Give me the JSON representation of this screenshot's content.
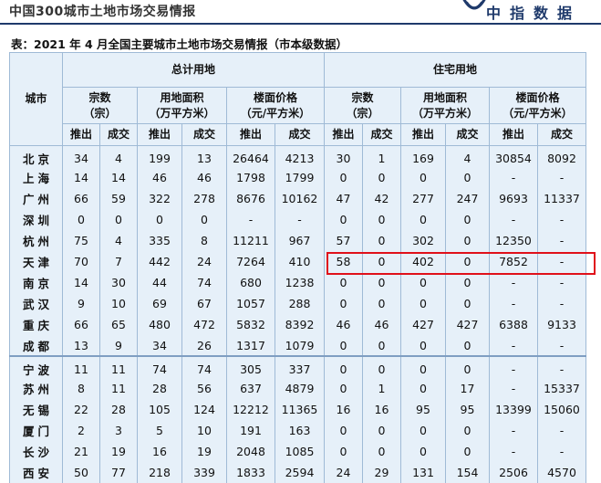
{
  "header": {
    "left_title": "中国300城市土地市场交易情报",
    "brand": "中指数据",
    "logo_icon": "zhongzhi-logo-icon"
  },
  "caption": "表：2021 年 4 月全国主要城市土地市场交易情报（市本级数据）",
  "table": {
    "city_header": "城市",
    "group1": "总计用地",
    "group2": "住宅用地",
    "sub_headers": [
      "宗数\n（宗）",
      "用地面积\n（万平方米）",
      "楼面价格\n（元/平方米）",
      "宗数\n（宗）",
      "用地面积\n（万平方米）",
      "楼面价格\n（元/平方米）"
    ],
    "pair_labels": [
      "推出",
      "成交"
    ],
    "group_a": [
      {
        "city": "北京",
        "cells": [
          "34",
          "4",
          "199",
          "13",
          "26464",
          "4213",
          "30",
          "1",
          "169",
          "4",
          "30854",
          "8092"
        ]
      },
      {
        "city": "上海",
        "cells": [
          "14",
          "14",
          "46",
          "46",
          "1798",
          "1799",
          "0",
          "0",
          "0",
          "0",
          "-",
          "-"
        ]
      },
      {
        "city": "广州",
        "cells": [
          "66",
          "59",
          "322",
          "278",
          "8676",
          "10162",
          "47",
          "42",
          "277",
          "247",
          "9693",
          "11337"
        ]
      },
      {
        "city": "深圳",
        "cells": [
          "0",
          "0",
          "0",
          "0",
          "-",
          "-",
          "0",
          "0",
          "0",
          "0",
          "-",
          "-"
        ]
      },
      {
        "city": "杭州",
        "cells": [
          "75",
          "4",
          "335",
          "8",
          "11211",
          "967",
          "57",
          "0",
          "302",
          "0",
          "12350",
          "-"
        ]
      },
      {
        "city": "天津",
        "cells": [
          "70",
          "7",
          "442",
          "24",
          "7264",
          "410",
          "58",
          "0",
          "402",
          "0",
          "7852",
          "-"
        ]
      },
      {
        "city": "南京",
        "cells": [
          "14",
          "30",
          "44",
          "74",
          "680",
          "1238",
          "0",
          "0",
          "0",
          "0",
          "-",
          "-"
        ]
      },
      {
        "city": "武汉",
        "cells": [
          "9",
          "10",
          "69",
          "67",
          "1057",
          "288",
          "0",
          "0",
          "0",
          "0",
          "-",
          "-"
        ]
      },
      {
        "city": "重庆",
        "cells": [
          "66",
          "65",
          "480",
          "472",
          "5832",
          "8392",
          "46",
          "46",
          "427",
          "427",
          "6388",
          "9133"
        ]
      },
      {
        "city": "成都",
        "cells": [
          "13",
          "9",
          "34",
          "26",
          "1317",
          "1079",
          "0",
          "0",
          "0",
          "0",
          "-",
          "-"
        ]
      }
    ],
    "group_b": [
      {
        "city": "宁波",
        "cells": [
          "11",
          "11",
          "74",
          "74",
          "305",
          "337",
          "0",
          "0",
          "0",
          "0",
          "-",
          "-"
        ]
      },
      {
        "city": "苏州",
        "cells": [
          "8",
          "11",
          "28",
          "56",
          "637",
          "4879",
          "0",
          "1",
          "0",
          "17",
          "-",
          "15337"
        ]
      },
      {
        "city": "无锡",
        "cells": [
          "22",
          "28",
          "105",
          "124",
          "12212",
          "11365",
          "16",
          "16",
          "95",
          "95",
          "13399",
          "15060"
        ]
      },
      {
        "city": "厦门",
        "cells": [
          "2",
          "3",
          "5",
          "10",
          "191",
          "163",
          "0",
          "0",
          "0",
          "0",
          "-",
          "-"
        ]
      },
      {
        "city": "长沙",
        "cells": [
          "21",
          "19",
          "16",
          "19",
          "2048",
          "1085",
          "0",
          "0",
          "0",
          "0",
          "-",
          "-"
        ]
      },
      {
        "city": "西安",
        "cells": [
          "50",
          "77",
          "218",
          "339",
          "1833",
          "2594",
          "24",
          "29",
          "131",
          "154",
          "2506",
          "4570"
        ]
      }
    ],
    "highlight_color": "#e0101a"
  }
}
